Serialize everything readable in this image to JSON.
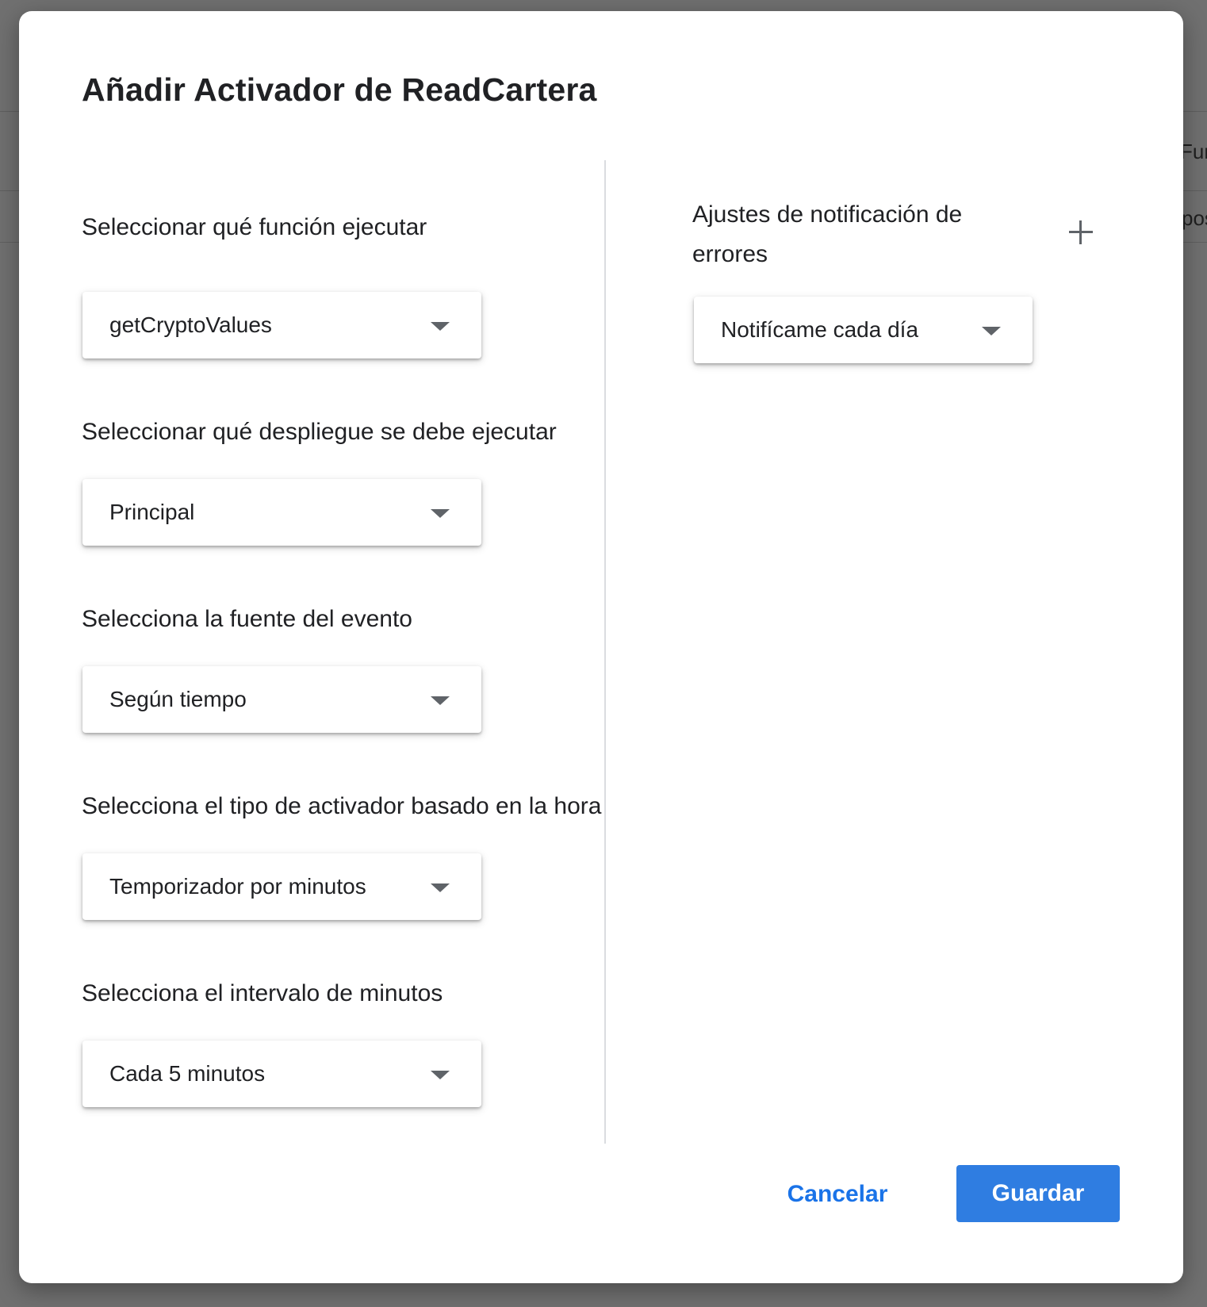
{
  "background": {
    "fragment_1": "Fur",
    "fragment_2": "pos"
  },
  "dialog": {
    "title": "Añadir Activador de ReadCartera",
    "fields": {
      "function": {
        "label": "Seleccionar qué función ejecutar",
        "value": "getCryptoValues"
      },
      "deployment": {
        "label": "Seleccionar qué despliegue se debe ejecutar",
        "value": "Principal"
      },
      "event_source": {
        "label": "Selecciona la fuente del evento",
        "value": "Según tiempo"
      },
      "trigger_type": {
        "label": "Selecciona el tipo de activador basado en la hora",
        "value": "Temporizador por minutos"
      },
      "interval": {
        "label": "Selecciona el intervalo de minutos",
        "value": "Cada 5 minutos"
      }
    },
    "notifications": {
      "label": "Ajustes de notificación de errores",
      "value": "Notifícame cada día",
      "add_icon": "plus-icon"
    },
    "actions": {
      "cancel_label": "Cancelar",
      "save_label": "Guardar"
    }
  },
  "colors": {
    "accent": "#1a73e8",
    "save_button": "#2f7de1",
    "scrim": "#707070"
  }
}
